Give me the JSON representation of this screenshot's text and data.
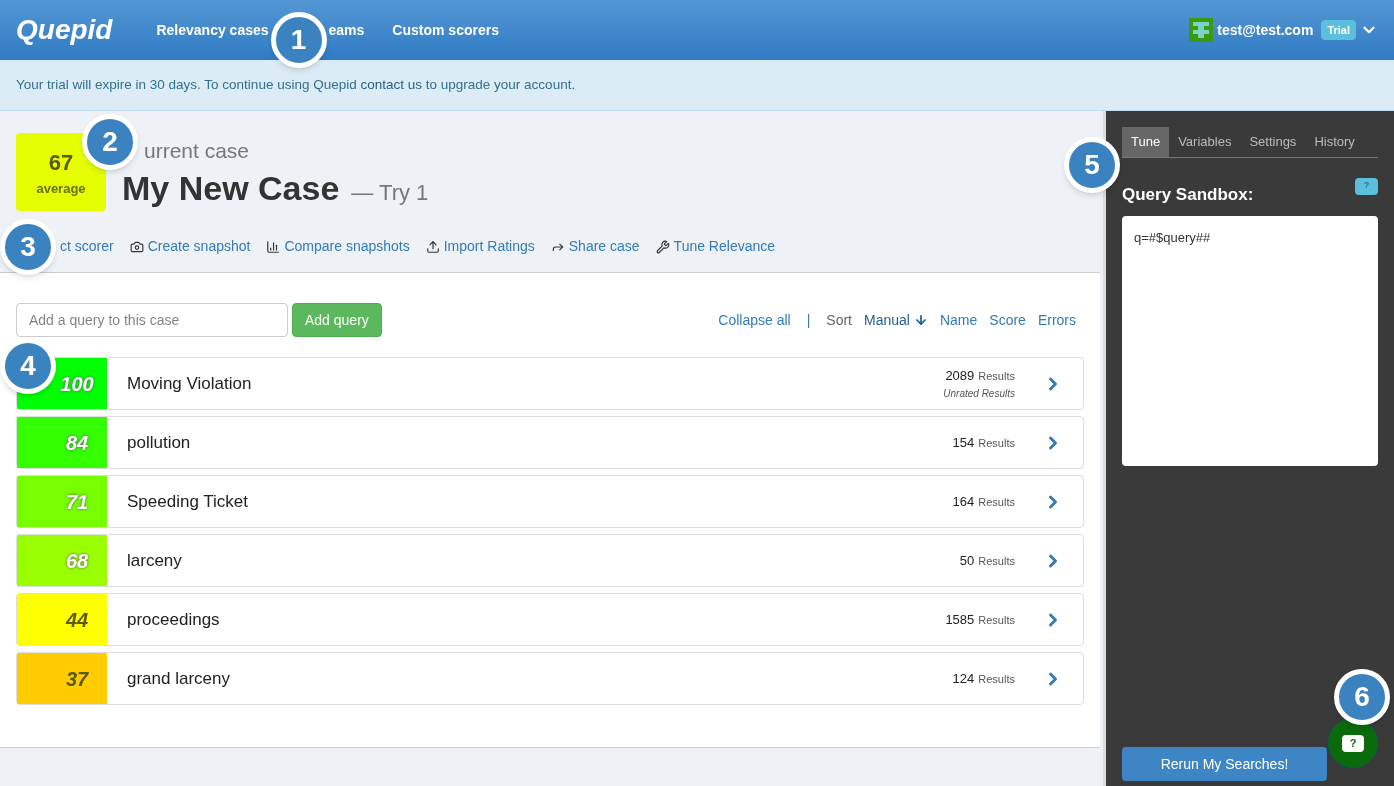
{
  "navbar": {
    "logo": "Quepid",
    "links": [
      {
        "label": "Relevancy cases"
      },
      {
        "label": "eams"
      },
      {
        "label": "Custom scorers"
      }
    ],
    "user": {
      "email": "test@test.com",
      "badge": "Trial"
    }
  },
  "notice": {
    "text": "Your trial will expire in 30 days. To continue using Quepid",
    "link": "contact us",
    "rest": "to upgrade your account."
  },
  "case": {
    "score": "67",
    "score_label": "average",
    "color": "#e5ff00",
    "subtitle": "urrent case",
    "title": "My New Case",
    "try": "— Try 1"
  },
  "actions": [
    {
      "label": "ct scorer"
    },
    {
      "label": "Create snapshot"
    },
    {
      "label": "Compare snapshots"
    },
    {
      "label": "Import Ratings"
    },
    {
      "label": "Share case"
    },
    {
      "label": "Tune Relevance"
    }
  ],
  "query_input": {
    "placeholder": "Add a query to this case",
    "button": "Add query"
  },
  "sort_bar": {
    "collapse": "Collapse all",
    "separator": "|",
    "sort_label": "Sort",
    "options": [
      {
        "label": "Manual",
        "selected": true
      },
      {
        "label": "Name",
        "selected": false
      },
      {
        "label": "Score",
        "selected": false
      },
      {
        "label": "Errors",
        "selected": false
      }
    ]
  },
  "queries": [
    {
      "score": "100",
      "color": "#00ff00",
      "query": "Moving Violation",
      "count": "2089",
      "count_label": "Results",
      "note": "Unrated Results"
    },
    {
      "score": "84",
      "color": "#33ff00",
      "query": "pollution",
      "count": "154",
      "count_label": "Results"
    },
    {
      "score": "71",
      "color": "#77ff00",
      "query": "Speeding Ticket",
      "count": "164",
      "count_label": "Results"
    },
    {
      "score": "68",
      "color": "#99ff00",
      "query": "larceny",
      "count": "50",
      "count_label": "Results"
    },
    {
      "score": "44",
      "color": "#ffff00",
      "query": "proceedings",
      "count": "1585",
      "count_label": "Results"
    },
    {
      "score": "37",
      "color": "#ffcc00",
      "query": "grand larceny",
      "count": "124",
      "count_label": "Results"
    }
  ],
  "sidebar": {
    "tabs": [
      {
        "label": "Tune",
        "selected": true
      },
      {
        "label": "Variables",
        "selected": false
      },
      {
        "label": "Settings",
        "selected": false
      },
      {
        "label": "History",
        "selected": false
      }
    ],
    "sandbox_title": "Query Sandbox:",
    "help": "?",
    "sandbox_value": "q=#$query##",
    "rerun": "Rerun My Searches!"
  },
  "chat_help": "?",
  "callouts": [
    "1",
    "2",
    "3",
    "4",
    "5",
    "6"
  ]
}
